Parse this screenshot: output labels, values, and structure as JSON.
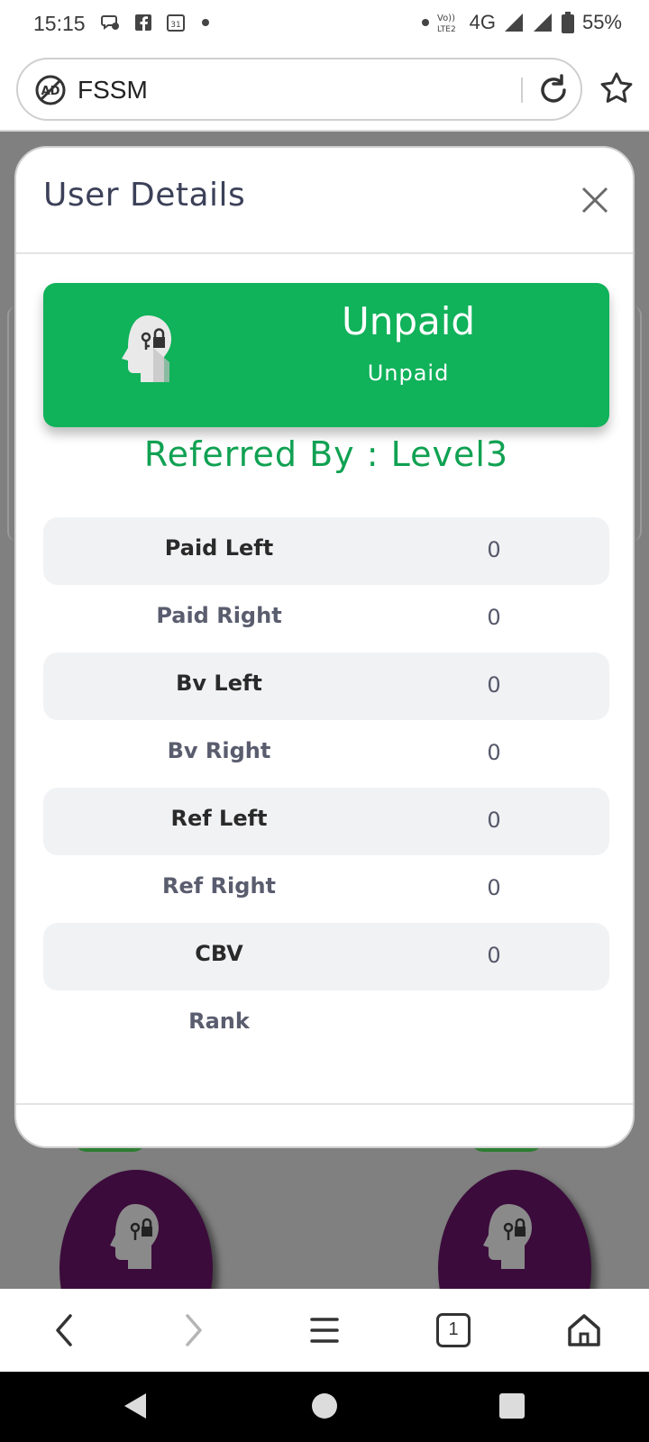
{
  "status_bar": {
    "time": "15:15",
    "network": "4G",
    "battery": "55%",
    "icons": [
      "chat-icon",
      "facebook-icon",
      "calendar-icon",
      "dot-icon",
      "volte-icon",
      "signal-icon",
      "battery-icon"
    ]
  },
  "browser": {
    "url_text": "FSSM",
    "icons": [
      "adblock-icon",
      "reload-icon",
      "star-icon"
    ]
  },
  "modal": {
    "title": "User Details",
    "status_card": {
      "title": "Unpaid",
      "subtitle": "Unpaid",
      "color": "#10b25a"
    },
    "referred_by": "Referred By : Level3",
    "rows": [
      {
        "label": "Paid Left",
        "value": "0"
      },
      {
        "label": "Paid Right",
        "value": "0"
      },
      {
        "label": "Bv Left",
        "value": "0"
      },
      {
        "label": "Bv Right",
        "value": "0"
      },
      {
        "label": "Ref Left",
        "value": "0"
      },
      {
        "label": "Ref Right",
        "value": "0"
      },
      {
        "label": "CBV",
        "value": "0"
      },
      {
        "label": "Rank",
        "value": ""
      }
    ]
  },
  "browser_nav": {
    "tab_count": "1",
    "icons": [
      "back-icon",
      "forward-icon",
      "menu-icon",
      "tabs-icon",
      "home-icon"
    ]
  },
  "android_nav": {
    "icons": [
      "android-back-icon",
      "android-home-icon",
      "android-recents-icon"
    ]
  },
  "colors": {
    "accent_green": "#10b25a",
    "referred_green": "#10a152",
    "bg_node_purple": "#3b0b3b",
    "overlay_gray": "#808080"
  }
}
